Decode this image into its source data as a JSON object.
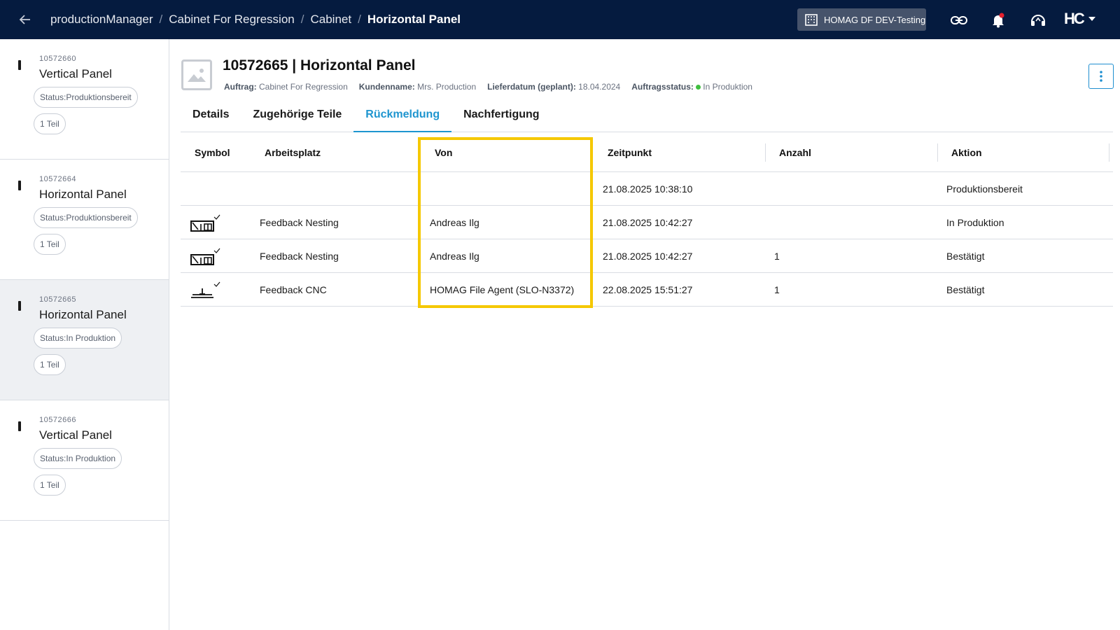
{
  "breadcrumb": [
    "productionManager",
    "Cabinet For Regression",
    "Cabinet",
    "Horizontal Panel"
  ],
  "tenant": "HOMAG DF DEV-Testing",
  "logo_text": "HC",
  "sidebar": {
    "items": [
      {
        "id": "10572660",
        "title": "Vertical Panel",
        "status": "Status:Produktionsbereit",
        "count": "1 Teil"
      },
      {
        "id": "10572664",
        "title": "Horizontal Panel",
        "status": "Status:Produktionsbereit",
        "count": "1 Teil"
      },
      {
        "id": "10572665",
        "title": "Horizontal Panel",
        "status": "Status:In Produktion",
        "count": "1 Teil"
      },
      {
        "id": "10572666",
        "title": "Vertical Panel",
        "status": "Status:In Produktion",
        "count": "1 Teil"
      }
    ]
  },
  "header": {
    "title": "10572665 | Horizontal Panel",
    "meta": [
      {
        "label": "Auftrag:",
        "value": "Cabinet For Regression"
      },
      {
        "label": "Kundenname:",
        "value": "Mrs. Production"
      },
      {
        "label": "Lieferdatum (geplant):",
        "value": "18.04.2024"
      },
      {
        "label": "Auftragsstatus:",
        "value": "In Produktion"
      }
    ]
  },
  "tabs": [
    "Details",
    "Zugehörige Teile",
    "Rückmeldung",
    "Nachfertigung"
  ],
  "table": {
    "headers": [
      "Symbol",
      "Arbeitsplatz",
      "Von",
      "Zeitpunkt",
      "Anzahl",
      "Aktion"
    ],
    "rows": [
      {
        "symbol": "",
        "arbeitsplatz": "",
        "von": "",
        "zeitpunkt": "21.08.2025 10:38:10",
        "anzahl": "",
        "aktion": "Produktionsbereit"
      },
      {
        "symbol": "nesting-icon",
        "arbeitsplatz": "Feedback Nesting",
        "von": "Andreas Ilg",
        "zeitpunkt": "21.08.2025 10:42:27",
        "anzahl": "",
        "aktion": "In Produktion"
      },
      {
        "symbol": "nesting-icon",
        "arbeitsplatz": "Feedback Nesting",
        "von": "Andreas Ilg",
        "zeitpunkt": "21.08.2025 10:42:27",
        "anzahl": "1",
        "aktion": "Bestätigt"
      },
      {
        "symbol": "cnc-icon",
        "arbeitsplatz": "Feedback CNC",
        "von": "HOMAG File Agent (SLO-N3372)",
        "zeitpunkt": "22.08.2025 15:51:27",
        "anzahl": "1",
        "aktion": "Bestätigt"
      }
    ]
  },
  "colors": {
    "topbar": "#051b3f",
    "accent": "#1e95cf",
    "highlight": "#f5c800",
    "status_dot": "#3fbf3f"
  }
}
